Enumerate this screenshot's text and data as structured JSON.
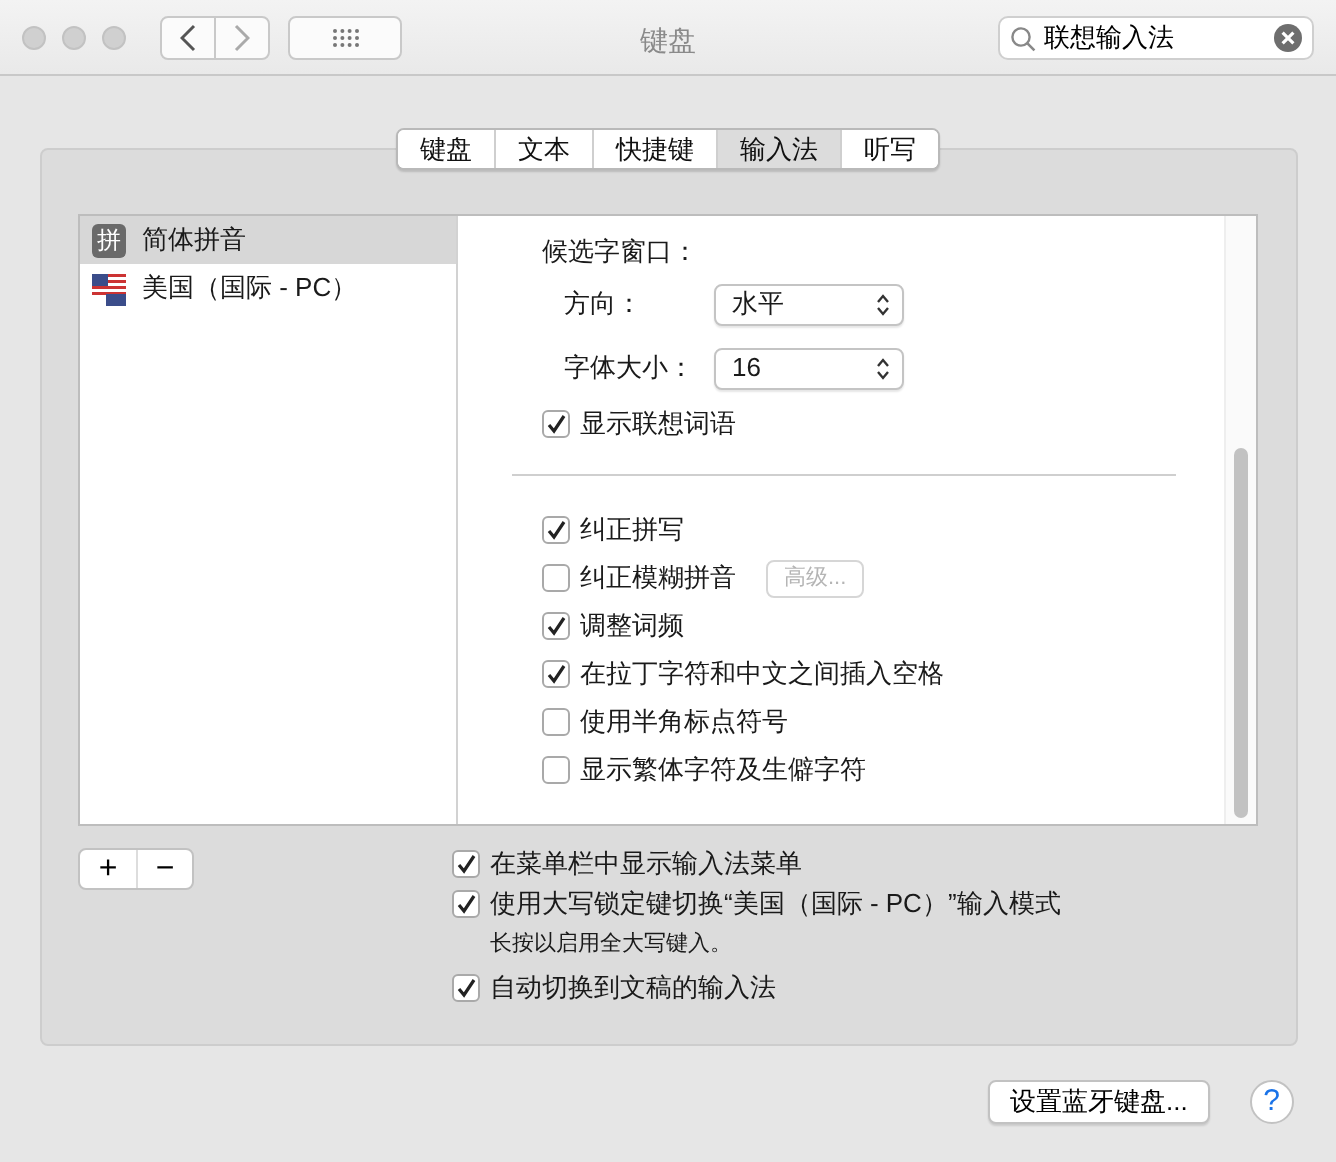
{
  "window": {
    "title": "键盘",
    "search": {
      "value": "联想输入法"
    }
  },
  "tabs": [
    {
      "label": "键盘",
      "selected": false
    },
    {
      "label": "文本",
      "selected": false
    },
    {
      "label": "快捷键",
      "selected": false
    },
    {
      "label": "输入法",
      "selected": true
    },
    {
      "label": "听写",
      "selected": false
    }
  ],
  "input_sources": [
    {
      "kind": "badge",
      "badge": "拼",
      "label": "简体拼音",
      "selected": true
    },
    {
      "kind": "flag",
      "label": "美国（国际 - PC）",
      "selected": false
    }
  ],
  "list_buttons": [
    "+",
    "−"
  ],
  "candidate_window": {
    "heading": "候选字窗口：",
    "fields": [
      {
        "label": "方向：",
        "value": "水平"
      },
      {
        "label": "字体大小：",
        "value": "16"
      }
    ],
    "option": {
      "label": "显示联想词语",
      "checked": true
    }
  },
  "options": [
    {
      "label": "纠正拼写",
      "checked": true
    },
    {
      "label": "纠正模糊拼音",
      "checked": false,
      "button": {
        "label": "高级...",
        "disabled": true
      }
    },
    {
      "label": "调整词频",
      "checked": true
    },
    {
      "label": "在拉丁字符和中文之间插入空格",
      "checked": true
    },
    {
      "label": "使用半角标点符号",
      "checked": false
    },
    {
      "label": "显示繁体字符及生僻字符",
      "checked": false
    }
  ],
  "general_options": [
    {
      "label": "在菜单栏中显示输入法菜单",
      "checked": true
    },
    {
      "label": "使用大写锁定键切换“美国（国际 - PC）”输入模式",
      "checked": true,
      "note": "长按以启用全大写键入。"
    },
    {
      "label": "自动切换到文稿的输入法",
      "checked": true
    }
  ],
  "footer": {
    "button": "设置蓝牙键盘...",
    "help": "?"
  }
}
